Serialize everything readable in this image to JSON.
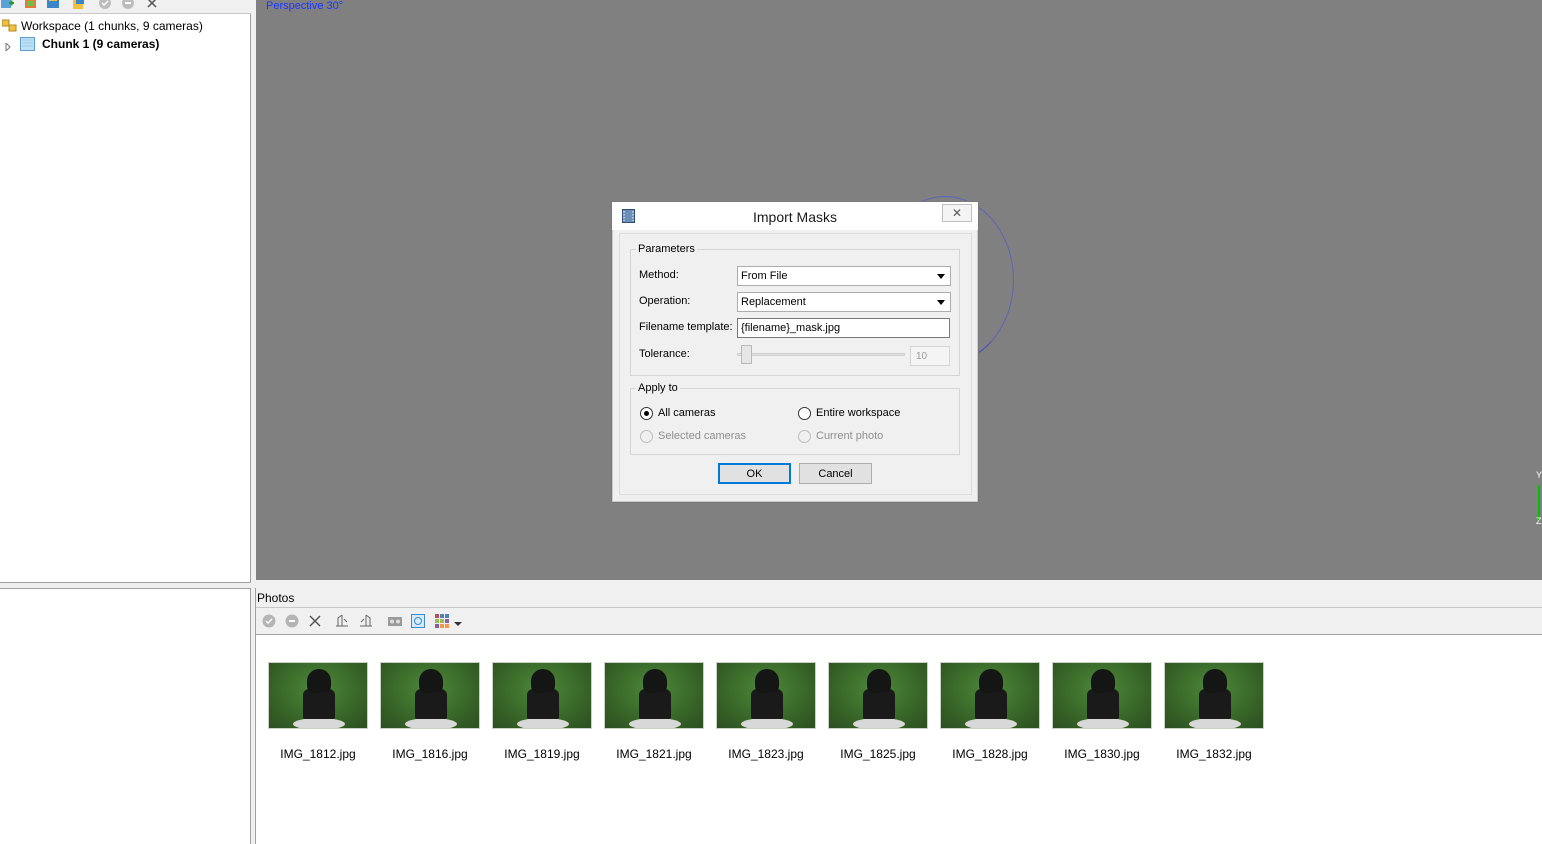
{
  "workspace": {
    "root_label": "Workspace (1 chunks, 9 cameras)",
    "chunk_label": "Chunk 1 (9 cameras)"
  },
  "viewport": {
    "projection_label": "Perspective 30°",
    "axis_y": "Y",
    "axis_z": "Z"
  },
  "photos": {
    "title": "Photos",
    "items": [
      {
        "name": "IMG_1812.jpg"
      },
      {
        "name": "IMG_1816.jpg"
      },
      {
        "name": "IMG_1819.jpg"
      },
      {
        "name": "IMG_1821.jpg"
      },
      {
        "name": "IMG_1823.jpg"
      },
      {
        "name": "IMG_1825.jpg"
      },
      {
        "name": "IMG_1828.jpg"
      },
      {
        "name": "IMG_1830.jpg"
      },
      {
        "name": "IMG_1832.jpg"
      }
    ]
  },
  "dialog": {
    "title": "Import Masks",
    "close_glyph": "✕",
    "parameters_group": "Parameters",
    "method_label": "Method:",
    "method_value": "From File",
    "operation_label": "Operation:",
    "operation_value": "Replacement",
    "filename_label": "Filename template:",
    "filename_value": "{filename}_mask.jpg",
    "tolerance_label": "Tolerance:",
    "tolerance_value": "10",
    "apply_group": "Apply to",
    "apply_options": {
      "all_cameras": "All cameras",
      "entire_workspace": "Entire workspace",
      "selected_cameras": "Selected cameras",
      "current_photo": "Current photo"
    },
    "selected_option": "All cameras",
    "ok_label": "OK",
    "cancel_label": "Cancel"
  },
  "colors": {
    "viewport_bg": "#808080",
    "projection_label": "#1a35ff",
    "default_button_border": "#0078d7"
  }
}
